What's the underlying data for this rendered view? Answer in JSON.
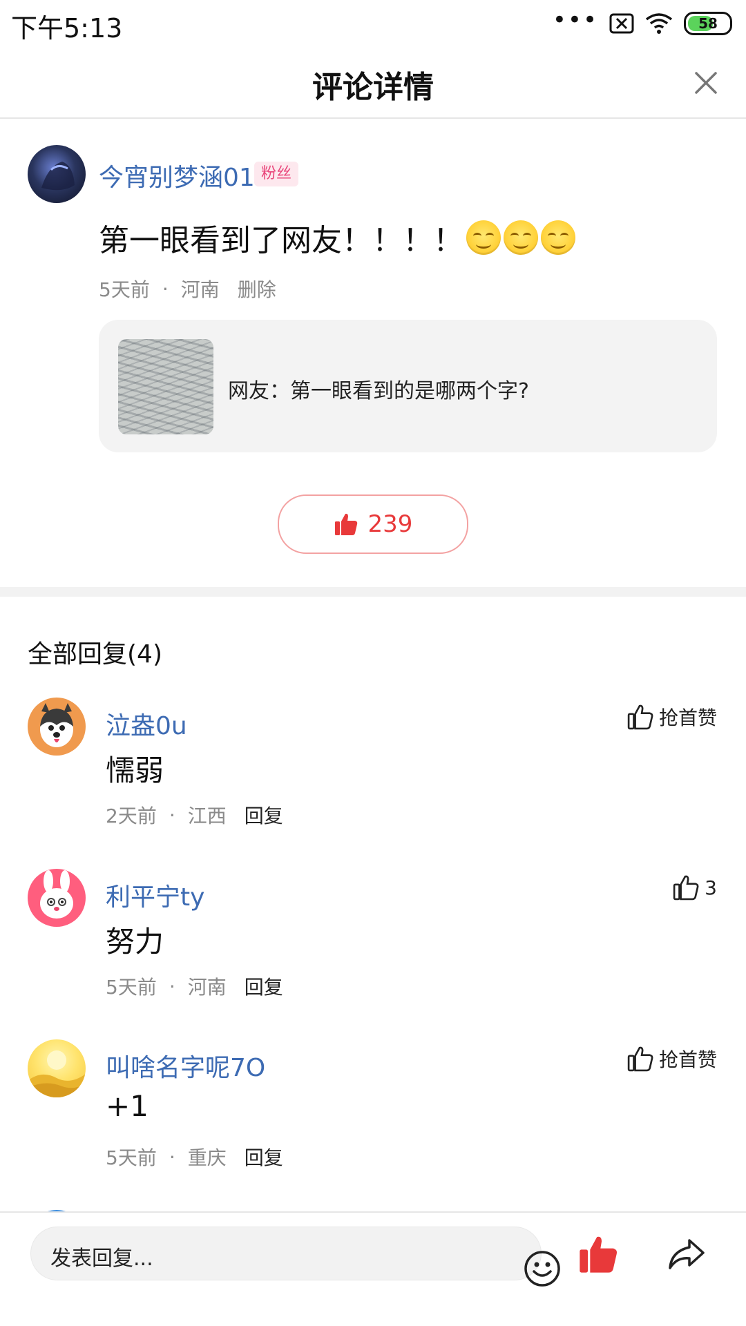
{
  "status_bar": {
    "time": "下午5:13",
    "battery": "58",
    "icons": [
      "more-dots-icon",
      "sim-x-icon",
      "wifi-icon",
      "battery-icon"
    ]
  },
  "header": {
    "title": "评论详情",
    "close_icon": "close-icon"
  },
  "main_comment": {
    "username": "今宵别梦涵01",
    "badge": "粉丝",
    "text": "第一眼看到了网友！！！！",
    "emoji_count": 3,
    "time": "5天前",
    "location": "河南",
    "delete": "删除",
    "quote": {
      "text": "网友：第一眼看到的是哪两个字?"
    },
    "likes": "239"
  },
  "replies_header": "全部回复(4)",
  "replies": [
    {
      "name": "泣盎0u",
      "text": "懦弱",
      "time": "2天前",
      "location": "江西",
      "reply": "回复",
      "like_label": "抢首赞"
    },
    {
      "name": "利平宁ty",
      "text": "努力",
      "time": "5天前",
      "location": "河南",
      "reply": "回复",
      "like_label": "3"
    },
    {
      "name": "叫啥名字呢7O",
      "text": "+1",
      "time": "5天前",
      "location": "重庆",
      "reply": "回复",
      "like_label": "抢首赞"
    }
  ],
  "separator_dot": "·",
  "bottom_bar": {
    "placeholder": "发表回复..."
  },
  "colors": {
    "username_blue": "#3d6bb3",
    "like_red": "#e8393a",
    "badge_pink": "#e9457a"
  }
}
